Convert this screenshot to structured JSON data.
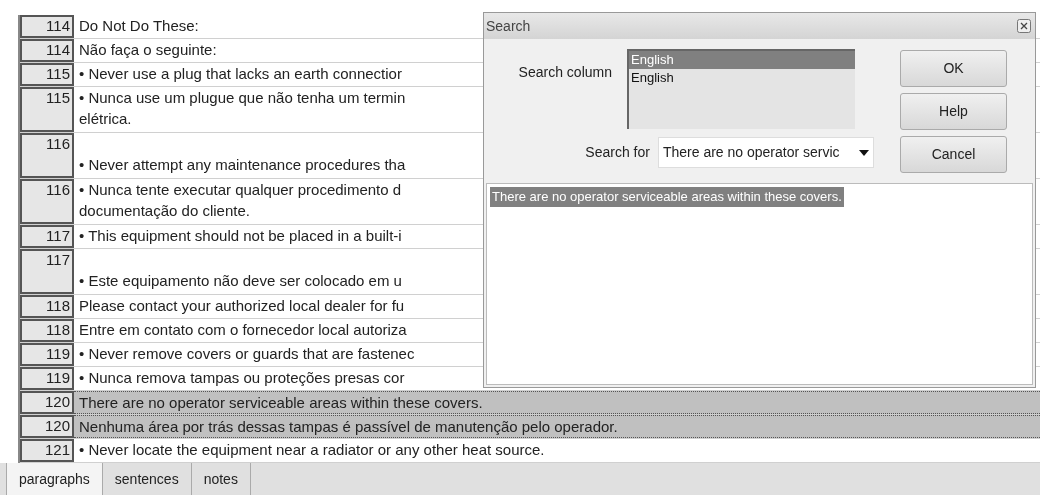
{
  "rows": [
    {
      "number": "114",
      "lines": [
        "Do Not Do These:"
      ],
      "selected": false
    },
    {
      "number": "114",
      "lines": [
        "Não faça o seguinte:"
      ],
      "selected": false
    },
    {
      "number": "115",
      "lines": [
        "• Never use a plug that lacks an earth connectior"
      ],
      "selected": false
    },
    {
      "number": "115",
      "lines": [
        "• Nunca use um plugue que não tenha um termin",
        "elétrica."
      ],
      "selected": false
    },
    {
      "number": "116",
      "lines": [
        "• Never attempt any maintenance procedures tha"
      ],
      "selected": false
    },
    {
      "number": "116",
      "lines": [
        "• Nunca tente executar qualquer procedimento d",
        "documentação do cliente."
      ],
      "selected": false
    },
    {
      "number": "117",
      "lines": [
        "• This equipment should not be placed in a built-i"
      ],
      "selected": false
    },
    {
      "number": "117",
      "lines": [
        "• Este equipamento não deve ser colocado em u"
      ],
      "selected": false
    },
    {
      "number": "118",
      "lines": [
        "Please contact your authorized local dealer for fu"
      ],
      "selected": false
    },
    {
      "number": "118",
      "lines": [
        "Entre em contato com o fornecedor local autoriza"
      ],
      "selected": false
    },
    {
      "number": "119",
      "lines": [
        "• Never remove covers or guards that are fastenec"
      ],
      "selected": false
    },
    {
      "number": "119",
      "lines": [
        "• Nunca remova tampas ou proteções presas cor"
      ],
      "selected": false
    },
    {
      "number": "120",
      "lines": [
        "There are no operator serviceable areas within these covers."
      ],
      "selected": true
    },
    {
      "number": "120",
      "lines": [
        "Nenhuma área por trás dessas tampas é passível de manutenção pelo operador."
      ],
      "selected": true
    },
    {
      "number": "121",
      "lines": [
        "• Never locate the equipment near a radiator or any other heat source."
      ],
      "selected": false
    }
  ],
  "dialog": {
    "title": "Search",
    "column_label": "Search column",
    "columns": [
      {
        "label": "English",
        "selected": true
      },
      {
        "label": "English",
        "selected": false
      }
    ],
    "search_label": "Search for",
    "search_value": "There are no operator servic",
    "buttons": [
      "OK",
      "Help",
      "Cancel"
    ],
    "results": [
      {
        "text": "There are no operator serviceable areas within these covers.",
        "selected": true
      }
    ]
  },
  "tabs": [
    {
      "label": "paragraphs",
      "selected": true
    },
    {
      "label": "sentences",
      "selected": false
    },
    {
      "label": "notes",
      "selected": false
    }
  ]
}
